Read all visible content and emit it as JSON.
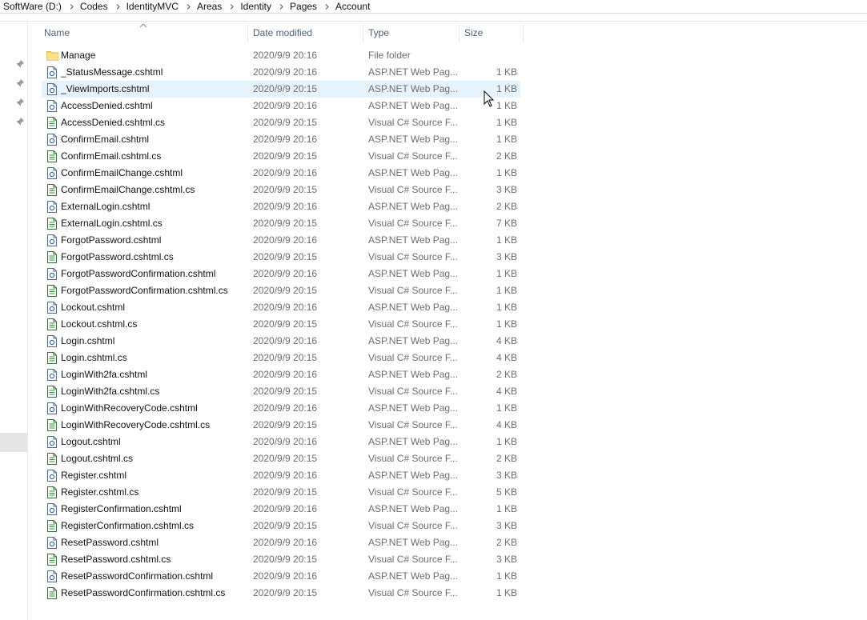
{
  "breadcrumb": [
    "SoftWare (D:)",
    "Codes",
    "IdentityMVC",
    "Areas",
    "Identity",
    "Pages",
    "Account"
  ],
  "columns": {
    "name": "Name",
    "date": "Date modified",
    "type": "Type",
    "size": "Size"
  },
  "files": [
    {
      "name": "Manage",
      "date": "2020/9/9 20:16",
      "type": "File folder",
      "size": "",
      "icon": "folder-icon"
    },
    {
      "name": "_StatusMessage.cshtml",
      "date": "2020/9/9 20:16",
      "type": "ASP.NET Web Pag...",
      "size": "1 KB",
      "icon": "cshtml-file-icon"
    },
    {
      "name": "_ViewImports.cshtml",
      "date": "2020/9/9 20:15",
      "type": "ASP.NET Web Pag...",
      "size": "1 KB",
      "icon": "cshtml-file-icon"
    },
    {
      "name": "AccessDenied.cshtml",
      "date": "2020/9/9 20:16",
      "type": "ASP.NET Web Pag...",
      "size": "1 KB",
      "icon": "cshtml-file-icon"
    },
    {
      "name": "AccessDenied.cshtml.cs",
      "date": "2020/9/9 20:15",
      "type": "Visual C# Source F...",
      "size": "1 KB",
      "icon": "cs-file-icon"
    },
    {
      "name": "ConfirmEmail.cshtml",
      "date": "2020/9/9 20:16",
      "type": "ASP.NET Web Pag...",
      "size": "1 KB",
      "icon": "cshtml-file-icon"
    },
    {
      "name": "ConfirmEmail.cshtml.cs",
      "date": "2020/9/9 20:15",
      "type": "Visual C# Source F...",
      "size": "2 KB",
      "icon": "cs-file-icon"
    },
    {
      "name": "ConfirmEmailChange.cshtml",
      "date": "2020/9/9 20:16",
      "type": "ASP.NET Web Pag...",
      "size": "1 KB",
      "icon": "cshtml-file-icon"
    },
    {
      "name": "ConfirmEmailChange.cshtml.cs",
      "date": "2020/9/9 20:15",
      "type": "Visual C# Source F...",
      "size": "3 KB",
      "icon": "cs-file-icon"
    },
    {
      "name": "ExternalLogin.cshtml",
      "date": "2020/9/9 20:16",
      "type": "ASP.NET Web Pag...",
      "size": "2 KB",
      "icon": "cshtml-file-icon"
    },
    {
      "name": "ExternalLogin.cshtml.cs",
      "date": "2020/9/9 20:15",
      "type": "Visual C# Source F...",
      "size": "7 KB",
      "icon": "cs-file-icon"
    },
    {
      "name": "ForgotPassword.cshtml",
      "date": "2020/9/9 20:16",
      "type": "ASP.NET Web Pag...",
      "size": "1 KB",
      "icon": "cshtml-file-icon"
    },
    {
      "name": "ForgotPassword.cshtml.cs",
      "date": "2020/9/9 20:15",
      "type": "Visual C# Source F...",
      "size": "3 KB",
      "icon": "cs-file-icon"
    },
    {
      "name": "ForgotPasswordConfirmation.cshtml",
      "date": "2020/9/9 20:16",
      "type": "ASP.NET Web Pag...",
      "size": "1 KB",
      "icon": "cshtml-file-icon"
    },
    {
      "name": "ForgotPasswordConfirmation.cshtml.cs",
      "date": "2020/9/9 20:15",
      "type": "Visual C# Source F...",
      "size": "1 KB",
      "icon": "cs-file-icon"
    },
    {
      "name": "Lockout.cshtml",
      "date": "2020/9/9 20:16",
      "type": "ASP.NET Web Pag...",
      "size": "1 KB",
      "icon": "cshtml-file-icon"
    },
    {
      "name": "Lockout.cshtml.cs",
      "date": "2020/9/9 20:15",
      "type": "Visual C# Source F...",
      "size": "1 KB",
      "icon": "cs-file-icon"
    },
    {
      "name": "Login.cshtml",
      "date": "2020/9/9 20:16",
      "type": "ASP.NET Web Pag...",
      "size": "4 KB",
      "icon": "cshtml-file-icon"
    },
    {
      "name": "Login.cshtml.cs",
      "date": "2020/9/9 20:15",
      "type": "Visual C# Source F...",
      "size": "4 KB",
      "icon": "cs-file-icon"
    },
    {
      "name": "LoginWith2fa.cshtml",
      "date": "2020/9/9 20:16",
      "type": "ASP.NET Web Pag...",
      "size": "2 KB",
      "icon": "cshtml-file-icon"
    },
    {
      "name": "LoginWith2fa.cshtml.cs",
      "date": "2020/9/9 20:15",
      "type": "Visual C# Source F...",
      "size": "4 KB",
      "icon": "cs-file-icon"
    },
    {
      "name": "LoginWithRecoveryCode.cshtml",
      "date": "2020/9/9 20:16",
      "type": "ASP.NET Web Pag...",
      "size": "1 KB",
      "icon": "cshtml-file-icon"
    },
    {
      "name": "LoginWithRecoveryCode.cshtml.cs",
      "date": "2020/9/9 20:15",
      "type": "Visual C# Source F...",
      "size": "4 KB",
      "icon": "cs-file-icon"
    },
    {
      "name": "Logout.cshtml",
      "date": "2020/9/9 20:16",
      "type": "ASP.NET Web Pag...",
      "size": "1 KB",
      "icon": "cshtml-file-icon"
    },
    {
      "name": "Logout.cshtml.cs",
      "date": "2020/9/9 20:15",
      "type": "Visual C# Source F...",
      "size": "2 KB",
      "icon": "cs-file-icon"
    },
    {
      "name": "Register.cshtml",
      "date": "2020/9/9 20:16",
      "type": "ASP.NET Web Pag...",
      "size": "3 KB",
      "icon": "cshtml-file-icon"
    },
    {
      "name": "Register.cshtml.cs",
      "date": "2020/9/9 20:15",
      "type": "Visual C# Source F...",
      "size": "5 KB",
      "icon": "cs-file-icon"
    },
    {
      "name": "RegisterConfirmation.cshtml",
      "date": "2020/9/9 20:16",
      "type": "ASP.NET Web Pag...",
      "size": "1 KB",
      "icon": "cshtml-file-icon"
    },
    {
      "name": "RegisterConfirmation.cshtml.cs",
      "date": "2020/9/9 20:15",
      "type": "Visual C# Source F...",
      "size": "3 KB",
      "icon": "cs-file-icon"
    },
    {
      "name": "ResetPassword.cshtml",
      "date": "2020/9/9 20:16",
      "type": "ASP.NET Web Pag...",
      "size": "2 KB",
      "icon": "cshtml-file-icon"
    },
    {
      "name": "ResetPassword.cshtml.cs",
      "date": "2020/9/9 20:15",
      "type": "Visual C# Source F...",
      "size": "3 KB",
      "icon": "cs-file-icon"
    },
    {
      "name": "ResetPasswordConfirmation.cshtml",
      "date": "2020/9/9 20:16",
      "type": "ASP.NET Web Pag...",
      "size": "1 KB",
      "icon": "cshtml-file-icon"
    },
    {
      "name": "ResetPasswordConfirmation.cshtml.cs",
      "date": "2020/9/9 20:15",
      "type": "Visual C# Source F...",
      "size": "1 KB",
      "icon": "cs-file-icon"
    }
  ],
  "hovered_row_index": 2,
  "colors": {
    "hover": "#e5f3ff",
    "header_text": "#4c607a",
    "folder": "#f8d775"
  }
}
